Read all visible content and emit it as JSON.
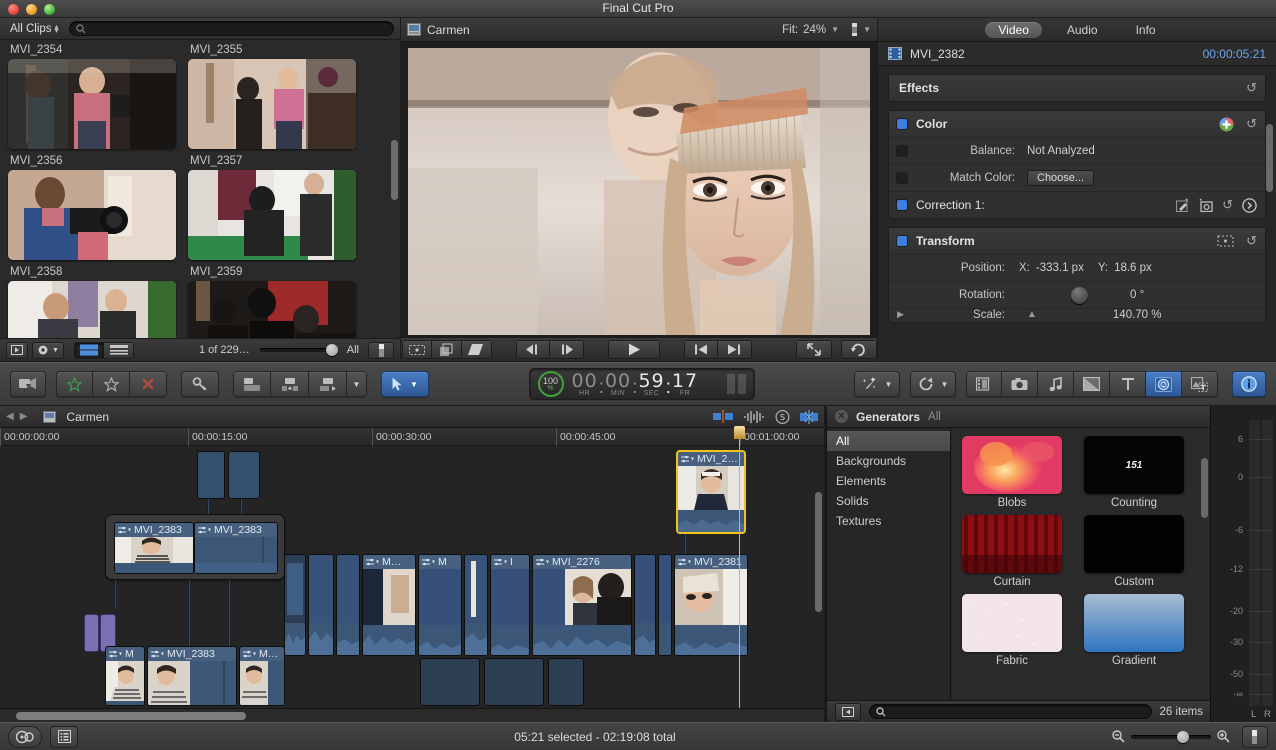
{
  "window": {
    "title": "Final Cut Pro"
  },
  "browser": {
    "library_selector": "All Clips",
    "search_placeholder": "",
    "search_value": "",
    "status_count": "1 of 229…",
    "filter_label": "All",
    "clips": [
      {
        "name": "MVI_2354"
      },
      {
        "name": "MVI_2355"
      },
      {
        "name": "MVI_2356"
      },
      {
        "name": "MVI_2357"
      },
      {
        "name": "MVI_2358"
      },
      {
        "name": "MVI_2359"
      }
    ]
  },
  "viewer": {
    "title": "Carmen",
    "fit_label": "Fit:",
    "zoom_value": "24%"
  },
  "inspector": {
    "tabs": [
      {
        "label": "Video",
        "active": true
      },
      {
        "label": "Audio",
        "active": false
      },
      {
        "label": "Info",
        "active": false
      }
    ],
    "clip_name": "MVI_2382",
    "clip_duration": "00:00:05:21",
    "effects_label": "Effects",
    "color": {
      "title": "Color",
      "balance_label": "Balance:",
      "balance_value": "Not Analyzed",
      "match_label": "Match Color:",
      "match_button": "Choose...",
      "correction_label": "Correction 1:"
    },
    "transform": {
      "title": "Transform",
      "position_label": "Position:",
      "x_label": "X:",
      "x_value": "-333.1 px",
      "y_label": "Y:",
      "y_value": "18.6 px",
      "rotation_label": "Rotation:",
      "rotation_value": "0 °",
      "scale_label": "Scale:",
      "scale_value": "140.70 %"
    }
  },
  "toolbar": {
    "timecode": {
      "hr": "00",
      "min": "00",
      "sec": "59",
      "fr": "17",
      "hr_label": "HR",
      "min_label": "MIN",
      "sec_label": "SEC",
      "fr_label": "FR",
      "gauge_value": "100",
      "gauge_unit": "%"
    }
  },
  "timeline": {
    "project_name": "Carmen",
    "ruler_ticks": [
      "00:00:00:00",
      "00:00:15:00",
      "00:00:30:00",
      "00:00:45:00",
      "00:01:00:00"
    ],
    "clips": [
      {
        "name": "MVI_2383"
      },
      {
        "name": "MVI_2383"
      },
      {
        "name": "M…"
      },
      {
        "name": "M"
      },
      {
        "name": "I"
      },
      {
        "name": "MVI_2276"
      },
      {
        "name": "MVI_2381"
      },
      {
        "name": "MVI_2…",
        "selected": true
      },
      {
        "name": "M"
      },
      {
        "name": "MVI_2383"
      },
      {
        "name": "M…"
      }
    ]
  },
  "generators": {
    "title": "Generators",
    "subtitle": "All",
    "categories": [
      {
        "label": "All",
        "active": true
      },
      {
        "label": "Backgrounds",
        "active": false
      },
      {
        "label": "Elements",
        "active": false
      },
      {
        "label": "Solids",
        "active": false
      },
      {
        "label": "Textures",
        "active": false
      }
    ],
    "items": [
      {
        "name": "Blobs"
      },
      {
        "name": "Counting",
        "overlay": "151"
      },
      {
        "name": "Curtain"
      },
      {
        "name": "Custom"
      },
      {
        "name": "Fabric"
      },
      {
        "name": "Gradient"
      }
    ],
    "search_placeholder": "",
    "item_count": "26 items"
  },
  "meters": {
    "ticks": [
      "6",
      "0",
      "-6",
      "-12",
      "-20",
      "-30",
      "-50",
      "-∞"
    ],
    "left_label": "L",
    "right_label": "R"
  },
  "status": {
    "text": "05:21 selected - 02:19:08 total"
  },
  "colors": {
    "accent_blue": "#3c7fe0",
    "selection_yellow": "#f0c419",
    "timecode_blue": "#6ba6e8",
    "playhead": "#e8b33b"
  }
}
